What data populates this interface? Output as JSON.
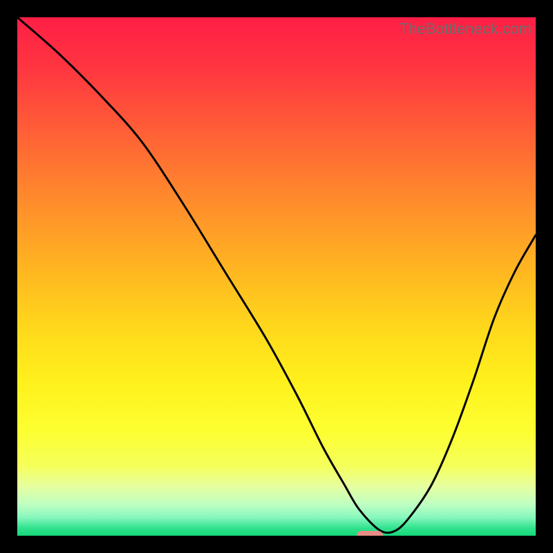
{
  "watermark": "TheBottleneck.com",
  "gradient_stops": [
    {
      "offset": 0.0,
      "color": "#ff1e46"
    },
    {
      "offset": 0.1,
      "color": "#ff3640"
    },
    {
      "offset": 0.2,
      "color": "#ff5838"
    },
    {
      "offset": 0.3,
      "color": "#ff7a30"
    },
    {
      "offset": 0.4,
      "color": "#ff9a28"
    },
    {
      "offset": 0.5,
      "color": "#ffba20"
    },
    {
      "offset": 0.6,
      "color": "#ffd81c"
    },
    {
      "offset": 0.7,
      "color": "#fff01c"
    },
    {
      "offset": 0.8,
      "color": "#fdff32"
    },
    {
      "offset": 0.865,
      "color": "#f5ff5a"
    },
    {
      "offset": 0.905,
      "color": "#e6ffa0"
    },
    {
      "offset": 0.94,
      "color": "#beffc2"
    },
    {
      "offset": 0.965,
      "color": "#86f7bd"
    },
    {
      "offset": 0.985,
      "color": "#31e28d"
    },
    {
      "offset": 1.0,
      "color": "#14d87a"
    }
  ],
  "chart_data": {
    "type": "line",
    "title": "",
    "xlabel": "",
    "ylabel": "",
    "xlim": [
      0,
      100
    ],
    "ylim": [
      0,
      100
    ],
    "series": [
      {
        "name": "curve",
        "x": [
          0,
          8,
          16,
          24,
          32,
          40,
          48,
          54,
          59,
          63,
          66,
          70,
          73,
          76,
          80,
          84,
          88,
          92,
          96,
          100
        ],
        "y": [
          100,
          93,
          85,
          76,
          64,
          51,
          38,
          27,
          17,
          10,
          5,
          1,
          1,
          4,
          10,
          19,
          30,
          42,
          51,
          58
        ]
      }
    ],
    "marker": {
      "x": 68,
      "y": 0,
      "color": "#e78b85"
    }
  }
}
